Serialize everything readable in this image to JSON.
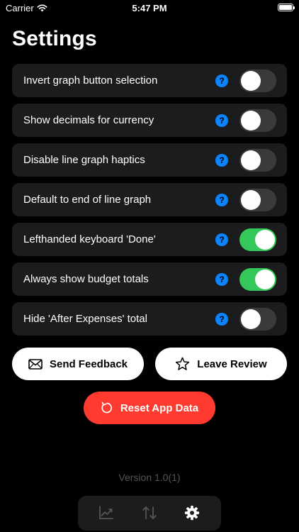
{
  "status_bar": {
    "carrier": "Carrier",
    "time": "5:47 PM"
  },
  "header": {
    "title": "Settings"
  },
  "settings": [
    {
      "label": "Invert graph button selection",
      "help": "?",
      "enabled": false
    },
    {
      "label": "Show decimals for currency",
      "help": "?",
      "enabled": false
    },
    {
      "label": "Disable line graph haptics",
      "help": "?",
      "enabled": false
    },
    {
      "label": "Default to end of line graph",
      "help": "?",
      "enabled": false
    },
    {
      "label": "Lefthanded keyboard 'Done'",
      "help": "?",
      "enabled": true
    },
    {
      "label": "Always show budget totals",
      "help": "?",
      "enabled": true
    },
    {
      "label": "Hide 'After Expenses' total",
      "help": "?",
      "enabled": false
    }
  ],
  "actions": {
    "feedback_label": "Send Feedback",
    "review_label": "Leave Review",
    "reset_label": "Reset App Data"
  },
  "footer": {
    "version": "Version 1.0(1)"
  },
  "tab_bar": {
    "tabs": [
      {
        "icon": "chart-line-icon",
        "selected": false
      },
      {
        "icon": "transfer-arrows-icon",
        "selected": false
      },
      {
        "icon": "gear-icon",
        "selected": true
      }
    ]
  },
  "colors": {
    "background": "#000000",
    "row_background": "#1c1c1e",
    "help_blue": "#0a84ff",
    "toggle_on": "#34c759",
    "toggle_off": "#3a3a3c",
    "reset_red": "#ff3b30",
    "version_gray": "#555555"
  }
}
